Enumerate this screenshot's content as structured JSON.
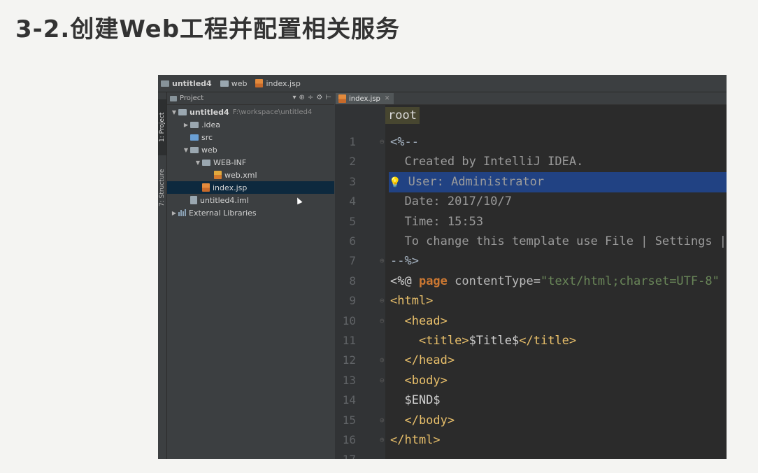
{
  "slide": {
    "title": "3-2.创建Web工程并配置相关服务"
  },
  "navbar": {
    "project": "untitled4",
    "folder": "web",
    "file": "index.jsp"
  },
  "tool_strip": {
    "project_tab": "1: Project",
    "structure_tab": "7: Structure"
  },
  "project_panel": {
    "header": "Project",
    "tree": [
      {
        "label": "untitled4",
        "hint": "F:\\workspace\\untitled4",
        "icon": "folder-icon",
        "arrow": "▼",
        "indent": 0
      },
      {
        "label": ".idea",
        "icon": "folder-icon",
        "arrow": "▶",
        "indent": 1
      },
      {
        "label": "src",
        "icon": "source-folder-icon",
        "arrow": "",
        "indent": 1
      },
      {
        "label": "web",
        "icon": "folder-icon",
        "arrow": "▼",
        "indent": 1
      },
      {
        "label": "WEB-INF",
        "icon": "folder-icon",
        "arrow": "▼",
        "indent": 2
      },
      {
        "label": "web.xml",
        "icon": "xml-file-icon",
        "arrow": "",
        "indent": 3
      },
      {
        "label": "index.jsp",
        "icon": "jsp-file-icon",
        "arrow": "",
        "indent": 2,
        "selected": true
      },
      {
        "label": "untitled4.iml",
        "icon": "iml-file-icon",
        "arrow": "",
        "indent": 1
      },
      {
        "label": "External Libraries",
        "icon": "library-icon",
        "arrow": "▶",
        "indent": 0
      }
    ]
  },
  "editor": {
    "tab_label": "index.jsp",
    "breadcrumb": "root",
    "lines": [
      {
        "no": "1",
        "parts": [
          {
            "t": "<%--",
            "c": "c-comment"
          }
        ]
      },
      {
        "no": "2",
        "parts": [
          {
            "t": "  Created by IntelliJ IDEA.",
            "c": "c-doc"
          }
        ]
      },
      {
        "no": "3",
        "parts": [
          {
            "t": "  User: Administrator",
            "c": "c-doc"
          }
        ],
        "highlight": true
      },
      {
        "no": "4",
        "parts": [
          {
            "t": "  Date: 2017/10/7",
            "c": "c-doc"
          }
        ]
      },
      {
        "no": "5",
        "parts": [
          {
            "t": "  Time: 15:53",
            "c": "c-doc"
          }
        ]
      },
      {
        "no": "6",
        "parts": [
          {
            "t": "  To change this template use File | Settings | File Templates.",
            "c": "c-doc"
          }
        ]
      },
      {
        "no": "7",
        "parts": [
          {
            "t": "--%>",
            "c": "c-comment"
          }
        ]
      },
      {
        "no": "8",
        "parts": [
          {
            "t": "<%@ ",
            "c": "c-var"
          },
          {
            "t": "page",
            "c": "c-kw"
          },
          {
            "t": " contentType=",
            "c": "c-attr"
          },
          {
            "t": "\"text/html;charset=UTF-8\"",
            "c": "c-str"
          }
        ]
      },
      {
        "no": "9",
        "parts": [
          {
            "t": "<html>",
            "c": "c-tag"
          }
        ]
      },
      {
        "no": "10",
        "parts": [
          {
            "t": "  <head>",
            "c": "c-tag"
          }
        ]
      },
      {
        "no": "11",
        "parts": [
          {
            "t": "    <title>",
            "c": "c-tag"
          },
          {
            "t": "$Title$",
            "c": "c-var"
          },
          {
            "t": "</title>",
            "c": "c-tag"
          }
        ]
      },
      {
        "no": "12",
        "parts": [
          {
            "t": "  </head>",
            "c": "c-tag"
          }
        ]
      },
      {
        "no": "13",
        "parts": [
          {
            "t": "  <body>",
            "c": "c-tag"
          }
        ]
      },
      {
        "no": "14",
        "parts": [
          {
            "t": "  $END$",
            "c": "c-var"
          }
        ]
      },
      {
        "no": "15",
        "parts": [
          {
            "t": "  </body>",
            "c": "c-tag"
          }
        ]
      },
      {
        "no": "16",
        "parts": [
          {
            "t": "</html>",
            "c": "c-tag"
          }
        ]
      },
      {
        "no": "17",
        "parts": []
      }
    ]
  }
}
